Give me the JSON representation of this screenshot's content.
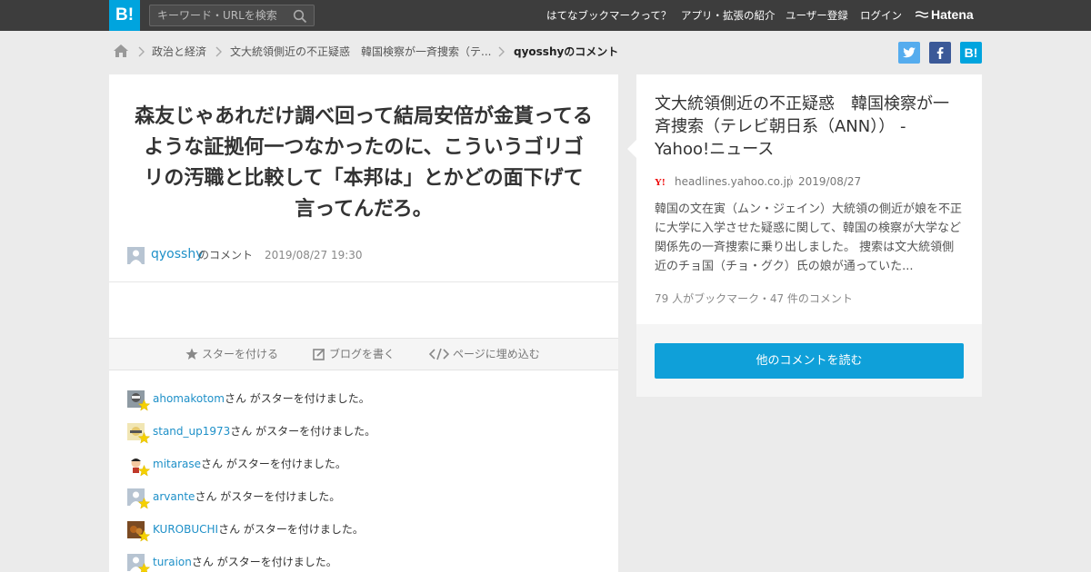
{
  "header": {
    "logo_text": "B!",
    "search_placeholder": "キーワード・URLを検索",
    "nav": [
      "はてなブックマークって？",
      "アプリ・拡張の紹介",
      "ユーザー登録",
      "ログイン"
    ],
    "brand": "Hatena"
  },
  "breadcrumb": {
    "items": [
      "政治と経済",
      "文大統領側近の不正疑惑　韓国検察が一斉捜索（テ...",
      "qyosshyのコメント"
    ]
  },
  "share": {
    "twitter": "twitter-icon",
    "facebook": "facebook-icon",
    "hatena": "B!"
  },
  "comment": {
    "text": "森友じゃあれだけ調べ回って結局安倍が金貰ってるような証拠何一つなかったのに、こういうゴリゴリの汚職と比較して「本邦は」とかどの面下げて言ってんだろ。",
    "user": "qyosshy",
    "user_suffix": "のコメント",
    "date": "2019/08/27 19:30"
  },
  "actions": {
    "star": "スターを付ける",
    "blog": "ブログを書く",
    "embed": "ページに埋め込む"
  },
  "stars": {
    "suffix": "さん がスターを付けました。",
    "users": [
      "ahomakotom",
      "stand_up1973",
      "mitarase",
      "arvante",
      "KUROBUCHI",
      "turaion"
    ]
  },
  "entry": {
    "title": "文大統領側近の不正疑惑　韓国検察が一斉捜索（テレビ朝日系（ANN）） - Yahoo!ニュース",
    "domain": "headlines.yahoo.co.jp",
    "date": "2019/08/27",
    "summary": "韓国の文在寅（ムン・ジェイン）大統領の側近が娘を不正に大学に入学させた疑惑に関して、韓国の検察が大学など関係先の一斉捜索に乗り出しました。 捜索は文大統領側近のチョ国（チョ・グク）氏の娘が通っていた...",
    "counts": "79 人がブックマーク・47 件のコメント",
    "more_button": "他のコメントを読む"
  },
  "colors": {
    "accent": "#00a4de",
    "header_bg": "#3d3d3d",
    "link": "#1e90c8",
    "star": "#f5d000"
  }
}
